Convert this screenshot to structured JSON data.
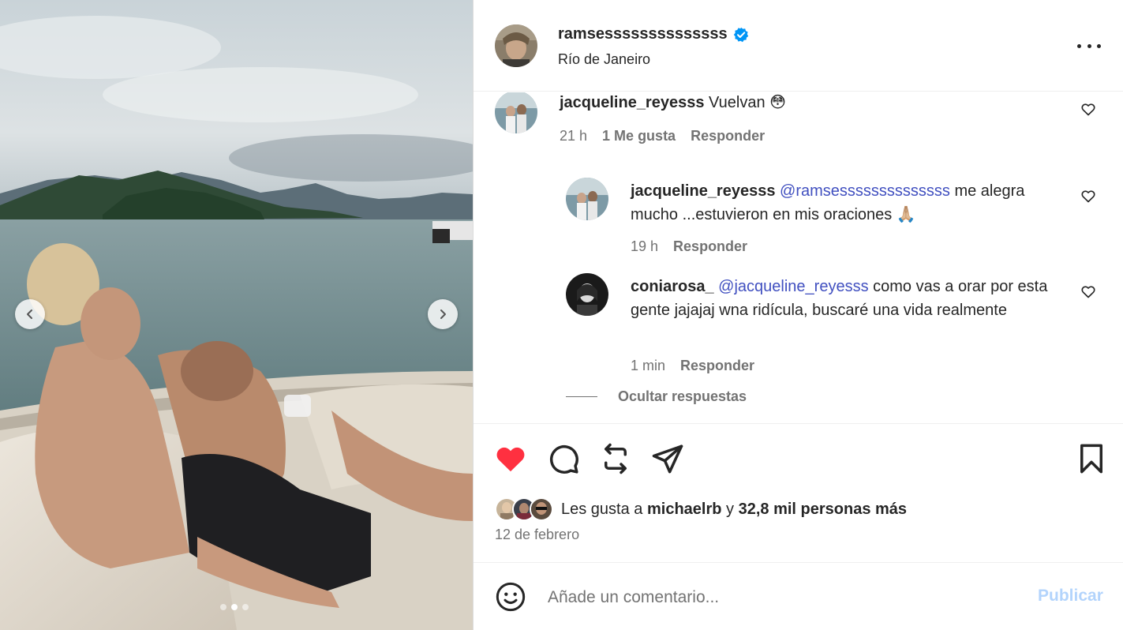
{
  "post": {
    "username": "ramsessssssssssssss",
    "location": "Río de Janeiro",
    "verified": true,
    "media_count": 3,
    "media_index": 2
  },
  "comments": [
    {
      "username": "jacqueline_reyesss",
      "text": "Vuelvan",
      "emoji": "😳",
      "time": "21 h",
      "likes": "1 Me gusta",
      "reply_label": "Responder"
    },
    {
      "username": "jacqueline_reyesss",
      "mention": "@ramsessssssssssssss",
      "text": "me alegra mucho ...estuvieron en mis oraciones",
      "emoji": "🙏🏼",
      "time": "19 h",
      "reply_label": "Responder"
    },
    {
      "username": "coniarosa_",
      "mention": "@jacqueline_reyesss",
      "text": "como vas a orar por esta gente jajajaj wna ridícula, buscaré una vida realmente",
      "time": "1 min",
      "reply_label": "Responder"
    }
  ],
  "hide_replies_label": "Ocultar respuestas",
  "actions": {
    "liked": true,
    "like_color": "#ff3040",
    "likes_prefix": "Les gusta a",
    "likes_user": "michaelrb",
    "likes_joiner": "y",
    "likes_rest": "32,8 mil personas más",
    "date": "12 de febrero"
  },
  "composer": {
    "placeholder": "Añade un comentario...",
    "publish_label": "Publicar",
    "publish_color": "#b3d4fc"
  },
  "icons": [
    "chevron-left-icon",
    "chevron-right-icon",
    "verified-icon",
    "more-icon",
    "heart-icon",
    "comment-icon",
    "repost-icon",
    "share-icon",
    "bookmark-icon",
    "emoji-icon"
  ]
}
